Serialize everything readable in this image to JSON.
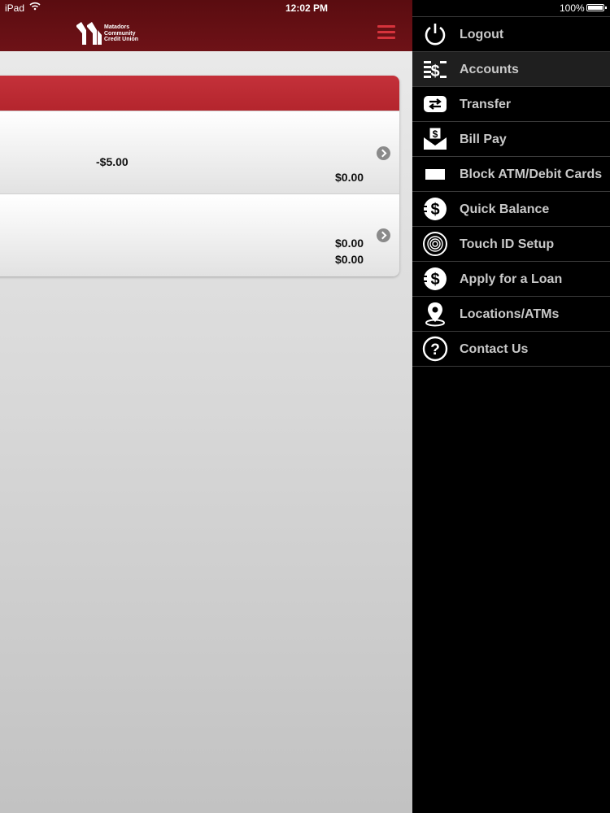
{
  "status_bar": {
    "carrier": "iPad",
    "time": "12:02 PM",
    "battery": "100%"
  },
  "header": {
    "logo_lines": [
      "Matadors",
      "Community",
      "Credit Union"
    ]
  },
  "accounts": {
    "rows": [
      {
        "amount_1": "-$5.00",
        "amount_2": "$0.00"
      },
      {
        "amount_1": "$0.00",
        "amount_2": "$0.00"
      }
    ]
  },
  "side_menu": {
    "items": [
      {
        "label": "Logout",
        "icon": "power-icon"
      },
      {
        "label": "Accounts",
        "icon": "accounts-icon",
        "active": true
      },
      {
        "label": "Transfer",
        "icon": "transfer-icon"
      },
      {
        "label": "Bill Pay",
        "icon": "bill-pay-icon"
      },
      {
        "label": "Block ATM/Debit Cards",
        "icon": "card-icon"
      },
      {
        "label": "Quick Balance",
        "icon": "dollar-icon"
      },
      {
        "label": "Touch ID Setup",
        "icon": "fingerprint-icon"
      },
      {
        "label": "Apply for a Loan",
        "icon": "dollar-icon"
      },
      {
        "label": "Locations/ATMs",
        "icon": "location-pin-icon"
      },
      {
        "label": "Contact Us",
        "icon": "question-icon"
      }
    ]
  },
  "colors": {
    "header": "#6e1217",
    "accent": "#c4313a",
    "menu_bg": "#000000",
    "menu_text": "#c9c9c9"
  }
}
